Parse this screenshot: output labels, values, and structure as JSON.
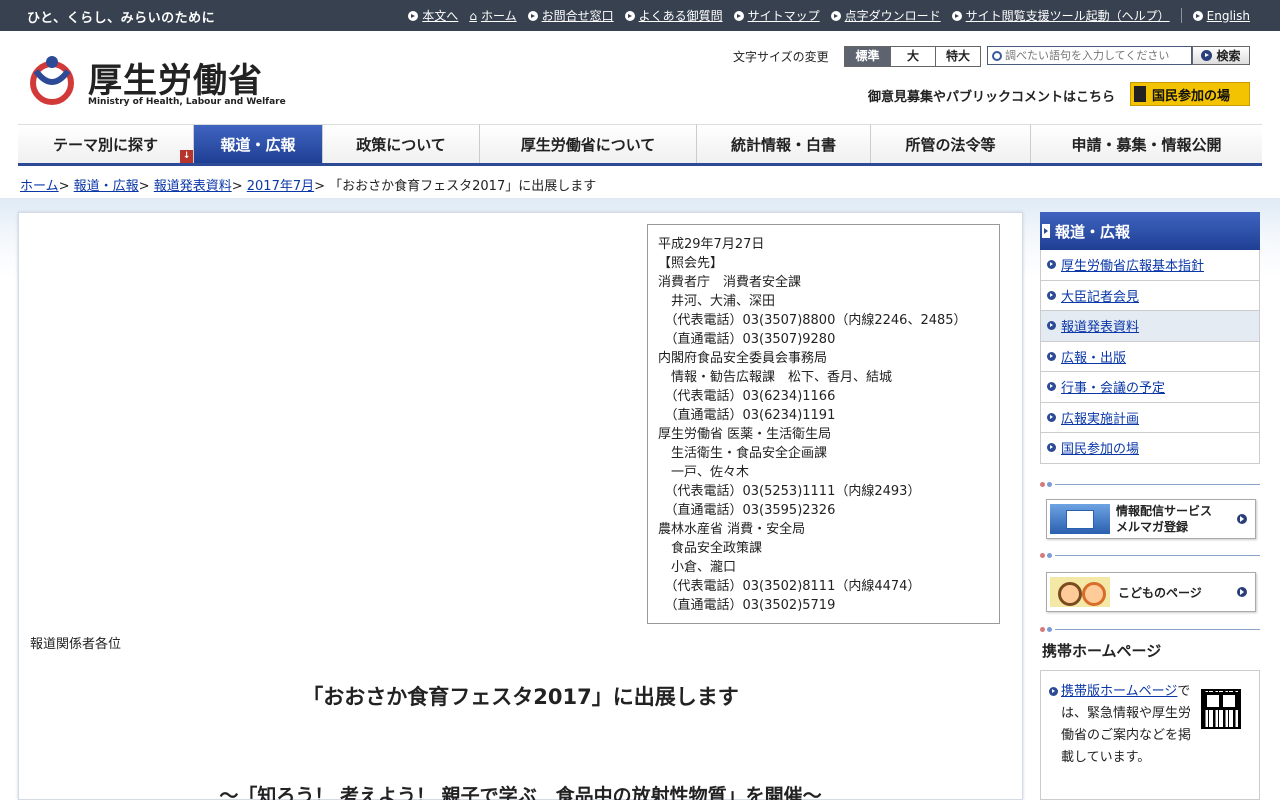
{
  "topbar": {
    "tagline": "ひと、くらし、みらいのために",
    "links": [
      "本文へ",
      "ホーム",
      "お問合せ窓口",
      "よくある御質問",
      "サイトマップ",
      "点字ダウンロード",
      "サイト閲覧支援ツール起動（ヘルプ）"
    ],
    "english": "English"
  },
  "header": {
    "logo_title": "厚生労働省",
    "logo_sub": "Ministry of Health, Labour and Welfare",
    "font_size_label": "文字サイズの変更",
    "font_sizes": [
      "標準",
      "大",
      "特大"
    ],
    "search_placeholder": "調べたい語句を入力してください",
    "search_button": "検索",
    "public_comment_text": "御意見募集やパブリックコメントはこちら",
    "public_comment_button": "国民参加の場"
  },
  "nav": [
    "テーマ別に探す",
    "報道・広報",
    "政策について",
    "厚生労働省について",
    "統計情報・白書",
    "所管の法令等",
    "申請・募集・情報公開"
  ],
  "breadcrumb": {
    "links": [
      "ホーム",
      "報道・広報",
      "報道発表資料",
      "2017年7月"
    ],
    "current": "「おおさか食育フェスタ2017」に出展します"
  },
  "contact": [
    "平成29年7月27日",
    "【照会先】",
    "消費者庁　消費者安全課",
    "　井河、大浦、深田",
    "　（代表電話）03(3507)8800（内線2246、2485）",
    "　（直通電話）03(3507)9280",
    "内閣府食品安全委員会事務局",
    "　情報・勧告広報課　松下、香月、結城",
    "　（代表電話）03(6234)1166",
    "　（直通電話）03(6234)1191",
    "厚生労働省 医薬・生活衛生局",
    "　生活衛生・食品安全企画課",
    "　一戸、佐々木",
    "　（代表電話）03(5253)1111（内線2493）",
    "　（直通電話）03(3595)2326",
    "農林水産省 消費・安全局",
    "　食品安全政策課",
    "　小倉、瀧口",
    "　（代表電話）03(3502)8111（内線4474）",
    "　（直通電話）03(3502)5719"
  ],
  "main": {
    "addressee": "報道関係者各位",
    "title": "「おおさか食育フェスタ2017」に出展します",
    "subtitle": "～「知ろう！ 考えよう！ 親子で学ぶ　食品中の放射性物質」を開催～"
  },
  "sidebar": {
    "heading": "報道・広報",
    "items": [
      "厚生労働省広報基本指針",
      "大臣記者会見",
      "報道発表資料",
      "広報・出版",
      "行事・会議の予定",
      "広報実施計画",
      "国民参加の場"
    ],
    "active_index": 2,
    "mail_banner": [
      "情報配信サービス",
      "メルマガ登録"
    ],
    "kids_banner": "こどものページ",
    "mobile_title": "携帯ホームページ",
    "mobile_link": "携帯版ホームページ",
    "mobile_text": "では、緊急情報や厚生労働省のご案内などを掲載しています。"
  },
  "colors": {
    "topbar": "#37414f",
    "nav_active": "#2c4a96",
    "link": "#0b38a8",
    "accent_yellow": "#f3c200"
  }
}
